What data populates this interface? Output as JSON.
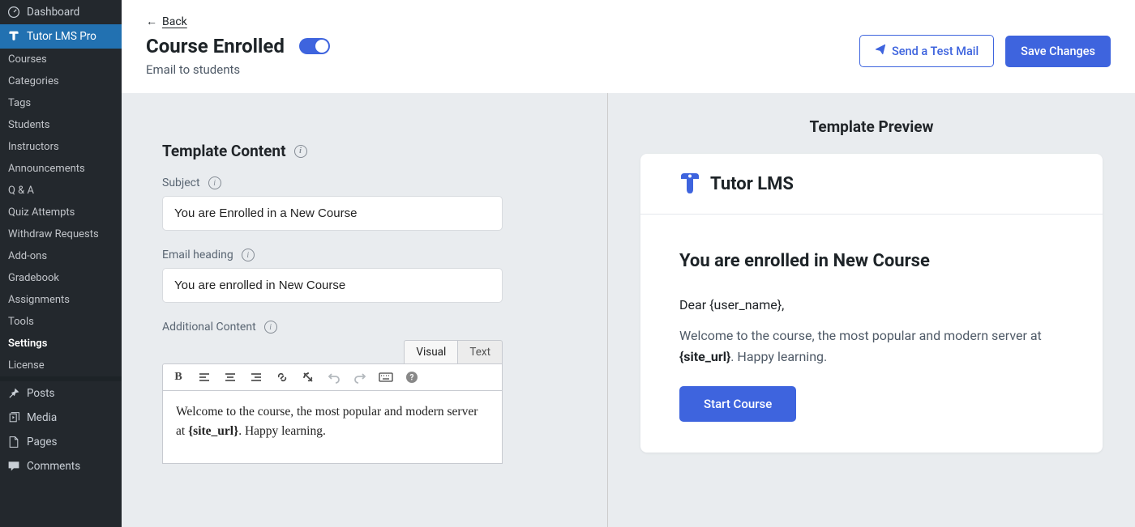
{
  "sidebar": {
    "dashboard": "Dashboard",
    "active": "Tutor LMS Pro",
    "sub": [
      "Courses",
      "Categories",
      "Tags",
      "Students",
      "Instructors",
      "Announcements",
      "Q & A",
      "Quiz Attempts",
      "Withdraw Requests",
      "Add-ons",
      "Gradebook",
      "Assignments",
      "Tools",
      "Settings",
      "License"
    ],
    "posts": "Posts",
    "media": "Media",
    "pages": "Pages",
    "comments": "Comments"
  },
  "header": {
    "back": "Back",
    "title": "Course Enrolled",
    "subtitle": "Email to students",
    "test_mail": "Send a Test Mail",
    "save": "Save Changes"
  },
  "form": {
    "section_title": "Template Content",
    "subject_label": "Subject",
    "subject_value": "You are Enrolled in a New Course",
    "heading_label": "Email heading",
    "heading_value": "You are enrolled in New Course",
    "additional_label": "Additional Content",
    "tab_visual": "Visual",
    "tab_text": "Text",
    "editor_body_pre": "Welcome to the course, the most popular and modern server at ",
    "editor_body_bold": "{site_url}",
    "editor_body_post": ". Happy learning."
  },
  "preview": {
    "title": "Template Preview",
    "brand": "Tutor LMS",
    "heading": "You are enrolled in New Course",
    "greeting": "Dear {user_name},",
    "para_pre": "Welcome to the course, the most popular and modern server at ",
    "para_bold": "{site_url}",
    "para_post": ". Happy learning.",
    "cta": "Start Course"
  }
}
